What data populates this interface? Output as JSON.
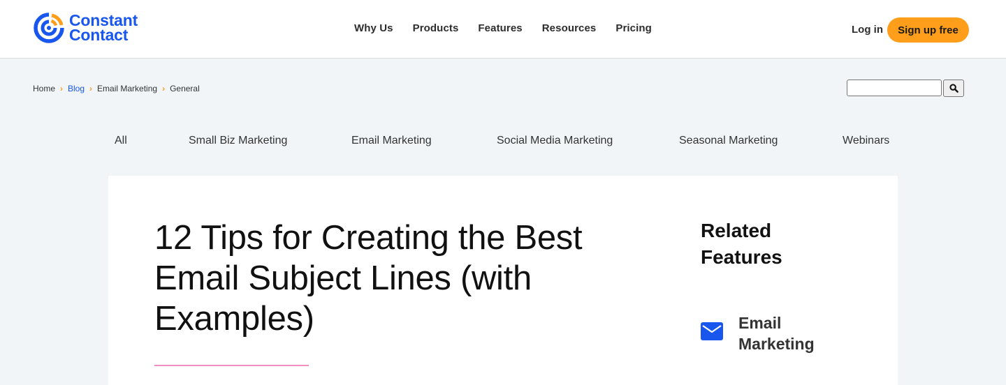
{
  "header": {
    "logo": {
      "line1": "Constant",
      "line2": "Contact",
      "icon": "constant-contact-logo-icon",
      "brand_blue": "#1856ed",
      "brand_orange": "#ff9e1b"
    },
    "nav": [
      "Why Us",
      "Products",
      "Features",
      "Resources",
      "Pricing"
    ],
    "login_label": "Log in",
    "signup_label": "Sign up free",
    "signup_color": "#ff9e1b"
  },
  "breadcrumb": {
    "items": [
      "Home",
      "Blog",
      "Email Marketing",
      "General"
    ],
    "active_color": "#1856ed",
    "separator_icon": "chevron-right-icon"
  },
  "search": {
    "value": "",
    "placeholder": "",
    "button_icon": "search-icon"
  },
  "categories": [
    "All",
    "Small Biz Marketing",
    "Email Marketing",
    "Social Media Marketing",
    "Seasonal Marketing",
    "Webinars"
  ],
  "article": {
    "title": "12 Tips for Creating the Best Email Subject Lines (with Examples)",
    "accent_rule_color": "#f38fc0"
  },
  "related": {
    "heading": "Related Features",
    "items": [
      {
        "label": "Email Marketing",
        "icon": "envelope-icon"
      }
    ]
  }
}
